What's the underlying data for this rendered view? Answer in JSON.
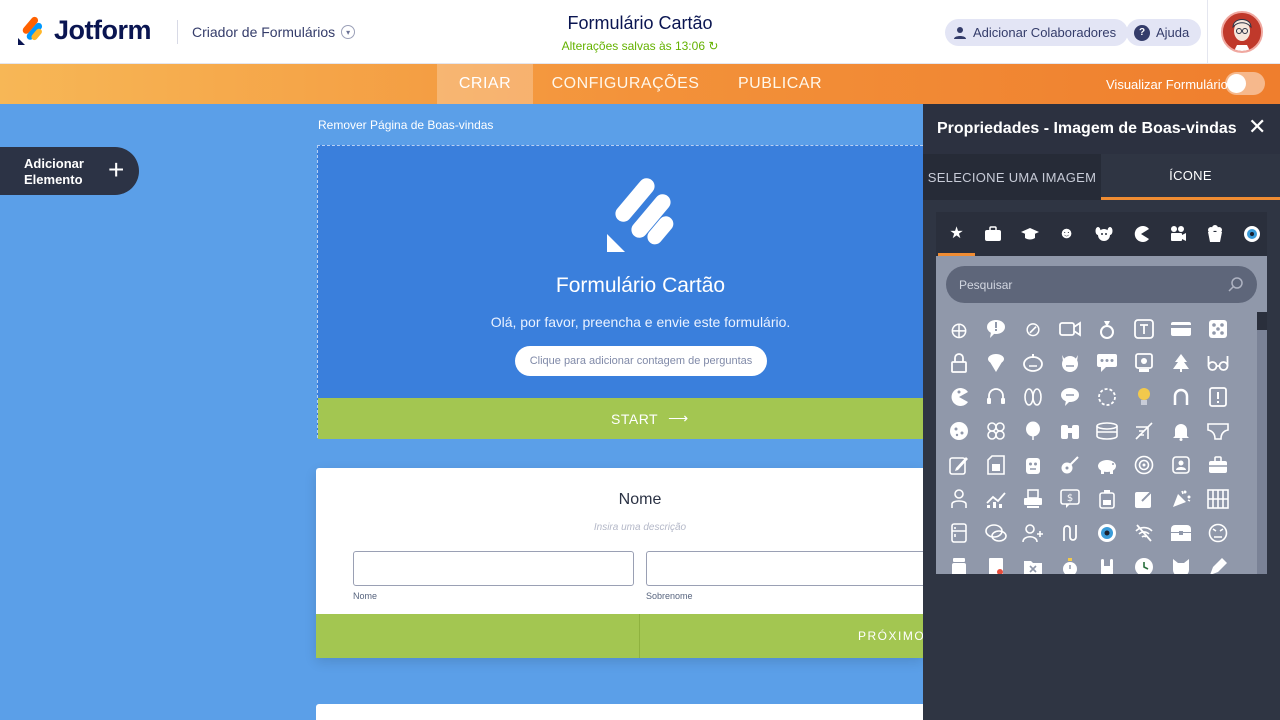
{
  "header": {
    "logo_text": "Jotform",
    "builder_label": "Criador de Formulários",
    "form_title": "Formulário Cartão",
    "save_status": "Alterações salvas às 13:06",
    "collab_label": "Adicionar Colaboradores",
    "help_label": "Ajuda"
  },
  "nav": {
    "tabs": [
      {
        "label": "CRIAR"
      },
      {
        "label": "CONFIGURAÇÕES"
      },
      {
        "label": "PUBLICAR"
      }
    ],
    "preview_label": "Visualizar Formulário"
  },
  "left": {
    "add_element_label": "Adicionar Elemento"
  },
  "canvas": {
    "remove_link": "Remover Página de Boas-vindas",
    "welcome_title": "Formulário Cartão",
    "welcome_description": "Olá, por favor, preencha e envie este formulário.",
    "question_count_label": "Clique para adicionar contagem de perguntas",
    "start_label": "START",
    "name_title": "Nome",
    "name_description": "Insira uma descrição",
    "first_label": "Nome",
    "last_label": "Sobrenome",
    "next_label": "PRÓXIMO"
  },
  "panel": {
    "title": "Propriedades - Imagem de Boas-vindas",
    "tabs": [
      {
        "label": "SELECIONE UMA IMAGEM"
      },
      {
        "label": "ÍCONE"
      }
    ],
    "search_placeholder": "Pesquisar"
  },
  "colors": {
    "orange_accent": "#f08c32",
    "canvas_blue": "#5b9fe8",
    "green": "#a3c651",
    "panel_dark": "#2f3543"
  }
}
